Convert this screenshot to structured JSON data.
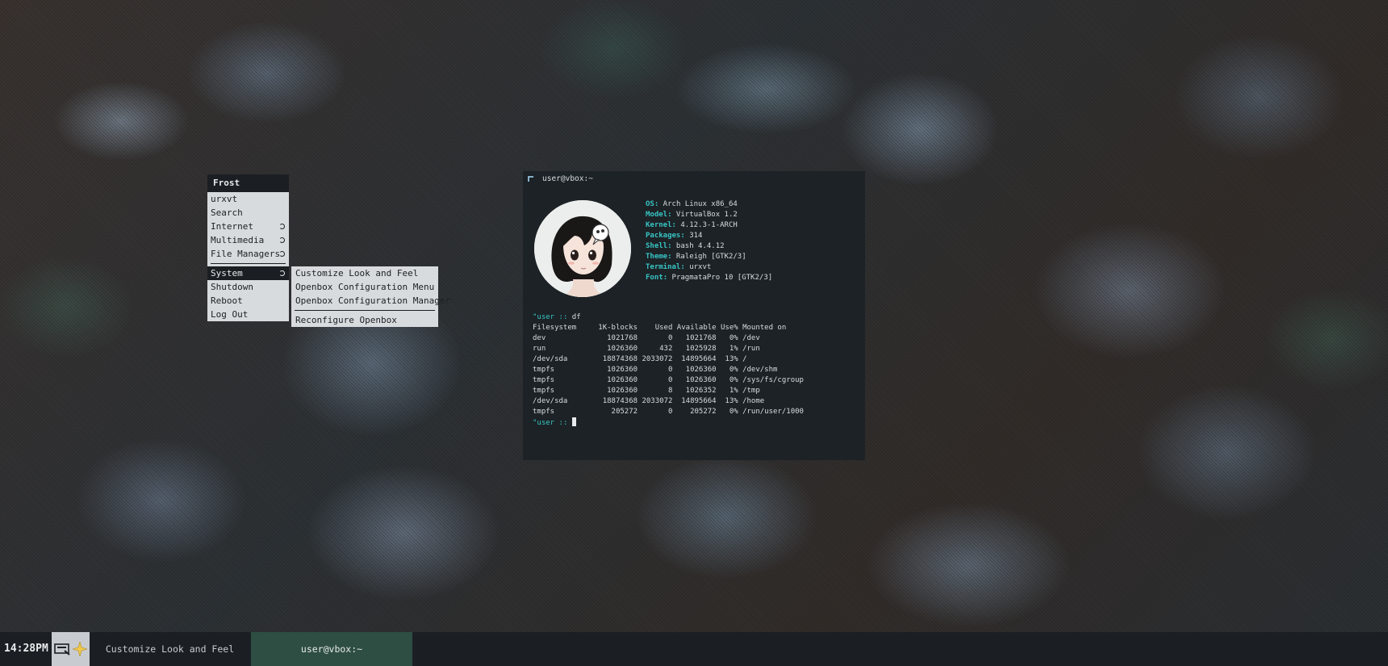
{
  "menu": {
    "title": "Frost",
    "items": [
      {
        "label": "urxvt"
      },
      {
        "label": "Search"
      },
      {
        "label": "Internet"
      },
      {
        "label": "Multimedia"
      },
      {
        "label": "File Managers"
      },
      {
        "label": "System"
      },
      {
        "label": "Shutdown"
      },
      {
        "label": "Reboot"
      },
      {
        "label": "Log Out"
      }
    ]
  },
  "submenu": {
    "items": [
      {
        "label": "Customize Look and Feel"
      },
      {
        "label": "Openbox Configuration Menu"
      },
      {
        "label": "Openbox Configuration Manager"
      },
      {
        "label": "Reconfigure Openbox"
      }
    ]
  },
  "terminal": {
    "title": "user@vbox:~",
    "neofetch": [
      {
        "key": "OS",
        "value": " Arch Linux x86_64"
      },
      {
        "key": "Model",
        "value": " VirtualBox 1.2"
      },
      {
        "key": "Kernel",
        "value": " 4.12.3-1-ARCH"
      },
      {
        "key": "Packages",
        "value": " 314"
      },
      {
        "key": "Shell",
        "value": " bash 4.4.12"
      },
      {
        "key": "Theme",
        "value": " Raleigh [GTK2/3]"
      },
      {
        "key": "Terminal",
        "value": " urxvt"
      },
      {
        "key": "Font",
        "value": " PragmataPro 10 [GTK2/3]"
      }
    ],
    "prompt_mark": "\"",
    "prompt_user": "user",
    "prompt_sep": " :: ",
    "command": "df",
    "df_lines": [
      "Filesystem     1K-blocks    Used Available Use% Mounted on",
      "dev              1021768       0   1021768   0% /dev",
      "run              1026360     432   1025928   1% /run",
      "/dev/sda        18874368 2033072  14895664  13% /",
      "tmpfs            1026360       0   1026360   0% /dev/shm",
      "tmpfs            1026360       0   1026360   0% /sys/fs/cgroup",
      "tmpfs            1026360       8   1026352   1% /tmp",
      "/dev/sda        18874368 2033072  14895664  13% /home",
      "tmpfs             205272       0    205272   0% /run/user/1000"
    ]
  },
  "taskbar": {
    "clock": "14:28PM",
    "tasks": [
      {
        "label": "Customize Look and Feel"
      },
      {
        "label": "user@vbox:~"
      }
    ]
  },
  "colors": {
    "accent_cyan": "#38c4c4",
    "active_task": "#2e4e43",
    "panel": "#1b1f23",
    "menu_bg": "#d8dbde"
  }
}
